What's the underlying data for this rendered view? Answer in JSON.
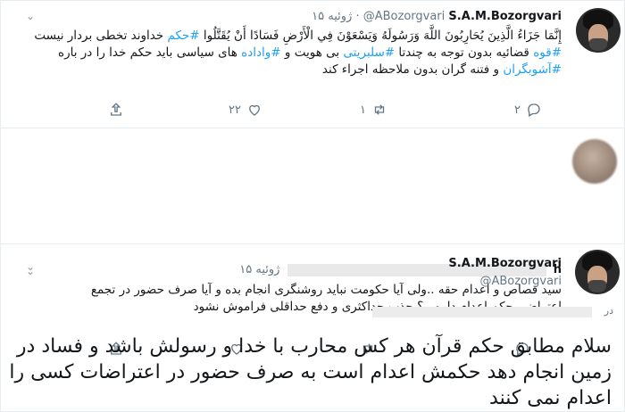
{
  "tweet1": {
    "name": "S.A.M.Bozorgvari",
    "handle": "@ABozorgvari",
    "separator": "·",
    "date": "۱۵ ژوئیه",
    "body_pre": "إِنَّمَا جَزَاءُ الَّذِينَ يُحَارِبُونَ اللَّهَ وَرَسُولَهُ وَيَسْعَوْنَ فِي الْأَرْضِ فَسَادًا أَنْ يُقَتَّلُوا ",
    "tag_hokm": "#حکم",
    "body_mid1": " خداوند تخطی بردار نیست ",
    "tag_qove": "#قوه",
    "body_mid2": " قضائیه بدون توجه به چندتا ",
    "tag_celeb": "#سلبریتی",
    "body_mid3": " بی هویت و ",
    "tag_vadade": "#واداده",
    "body_mid4": " های سیاسی باید حکم خدا را در باره ",
    "tag_ashub": "#آشوبگران",
    "body_end": " و فتنه گران بدون ملاحظه اجراء کند",
    "reply_count": "۲",
    "retweet_count": "۱",
    "like_count": "۲۲"
  },
  "tweet2": {
    "date": "۱۵ ژوئیه",
    "name_tail": "h",
    "body": "سید قصاص و اعدام حقه ..ولی آیا حکومت نباید روشنگری انجام بده و آیا صرف حضور در تجمع اعتراضی حکم اعدام داره ..؟ جذب حداکثری و دفع حداقلی فراموش نشود",
    "reply_count": "",
    "retweet_count": "",
    "like_count": ""
  },
  "tweet3": {
    "name": "S.A.M.Bozorgvari",
    "handle": "@ABozorgvari",
    "reply_prefix": "در",
    "big_text": "سلام مطابق حکم قرآن هر کس محارب با خدا و رسولش باشد و فساد در زمین انجام دهد حکمش اعدام است به صرف حضور در اعتراضات کسی را اعدام نمی کنند"
  },
  "icons": {
    "caret": "chevron-down-icon",
    "reply": "reply-icon",
    "retweet": "retweet-icon",
    "like": "heart-icon",
    "share": "share-icon"
  },
  "colors": {
    "hashtag": "#1da1f2",
    "muted": "#657786",
    "border": "#e6ecf0"
  }
}
